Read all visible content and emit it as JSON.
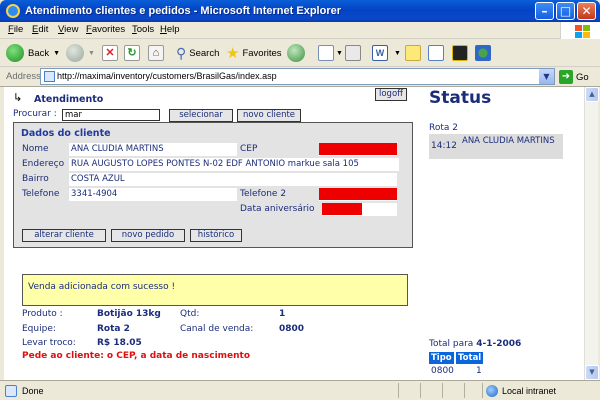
{
  "window": {
    "title": "Atendimento clientes e pedidos - Microsoft Internet Explorer",
    "min_glyph": "–",
    "max_glyph": "□",
    "close_glyph": "✕"
  },
  "menu": [
    "File",
    "Edit",
    "View",
    "Favorites",
    "Tools",
    "Help"
  ],
  "toolbar": {
    "back_label": "Back",
    "search_label": "Search",
    "favorites_label": "Favorites"
  },
  "address": {
    "label": "Address",
    "url": "http://maxima/inventory/customers/BrasilGas/index.asp",
    "go_label": "Go"
  },
  "page": {
    "atendimento_title": "Atendimento",
    "logoff_label": "logoff",
    "procurar_label": "Procurar :",
    "procurar_value": "mar",
    "selecionar_label": "selecionar",
    "novo_cliente_label": "novo cliente",
    "dados": {
      "title": "Dados do cliente",
      "nome_label": "Nome",
      "nome_value": "ANA CLUDIA MARTINS",
      "cep_label": "CEP",
      "endereco_label": "Endereço",
      "endereco_value": "RUA AUGUSTO LOPES PONTES N-02 EDF ANTONIO markue sala 105",
      "bairro_label": "Bairro",
      "bairro_value": "COSTA AZUL",
      "telefone_label": "Telefone",
      "telefone_value": "3341-4904",
      "telefone2_label": "Telefone 2",
      "aniversario_label": "Data aniversário",
      "alterar_label": "alterar cliente",
      "novo_pedido_label": "novo pedido",
      "historico_label": "histórico"
    },
    "message": "Venda adicionada com sucesso !",
    "produto_label": "Produto :",
    "produto_value": "Botijão 13kg",
    "qtd_label": "Qtd:",
    "qtd_value": "1",
    "equipe_label": "Equipe:",
    "equipe_value": "Rota 2",
    "canal_label": "Canal de venda:",
    "canal_value": "0800",
    "levar_troco_label": "Levar troco:",
    "levar_troco_value": "R$ 18.05",
    "warning": "Pede ao cliente: o CEP, a data de nascimento"
  },
  "status": {
    "title": "Status",
    "route": "Rota 2",
    "order_time": "14:12",
    "order_customer": "ANA CLUDIA MARTINS",
    "total_prefix": "Total para",
    "total_date": "4-1-2006",
    "table_headers": [
      "Tipo",
      "Total"
    ],
    "table_row": [
      "0800",
      "1"
    ]
  },
  "statusbar": {
    "done": "Done",
    "zone": "Local intranet"
  },
  "colors": {
    "title_bar": "#0344c4",
    "page_text": "#1b2d7a",
    "redacted": "#ee0000",
    "message_bg": "#ffffaa",
    "warning": "#dd1111",
    "table_header": "#0a66dd"
  }
}
